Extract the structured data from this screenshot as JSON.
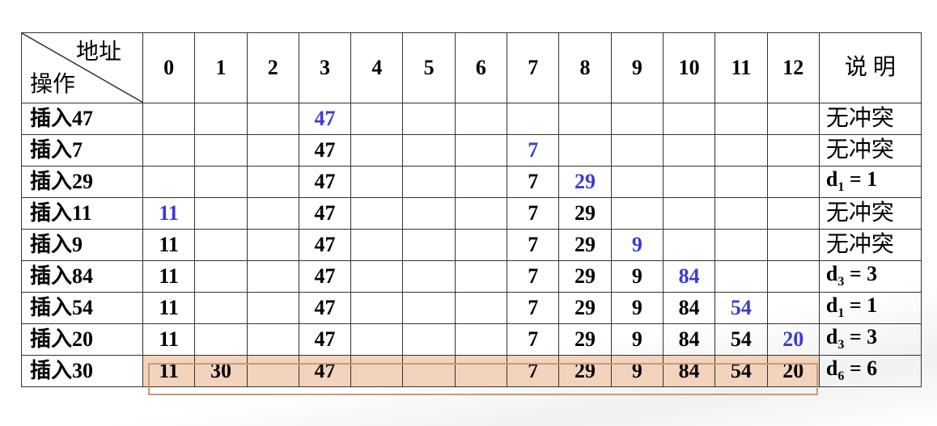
{
  "header": {
    "corner_top": "地址",
    "corner_bottom": "操作",
    "addresses": [
      "0",
      "1",
      "2",
      "3",
      "4",
      "5",
      "6",
      "7",
      "8",
      "9",
      "10",
      "11",
      "12"
    ],
    "note": "说 明"
  },
  "rows": [
    {
      "op": "插入47",
      "cells": [
        "",
        "",
        "",
        "47",
        "",
        "",
        "",
        "",
        "",
        "",
        "",
        "",
        ""
      ],
      "new_index": 3,
      "note": "无冲突",
      "note_type": "text"
    },
    {
      "op": "插入7",
      "cells": [
        "",
        "",
        "",
        "47",
        "",
        "",
        "",
        "7",
        "",
        "",
        "",
        "",
        ""
      ],
      "new_index": 7,
      "note": "无冲突",
      "note_type": "text"
    },
    {
      "op": "插入29",
      "cells": [
        "",
        "",
        "",
        "47",
        "",
        "",
        "",
        "7",
        "29",
        "",
        "",
        "",
        ""
      ],
      "new_index": 8,
      "note": {
        "d": "d",
        "sub": "1",
        "rest": " = 1"
      },
      "note_type": "eq"
    },
    {
      "op": "插入11",
      "cells": [
        "11",
        "",
        "",
        "47",
        "",
        "",
        "",
        "7",
        "29",
        "",
        "",
        "",
        ""
      ],
      "new_index": 0,
      "note": "无冲突",
      "note_type": "text"
    },
    {
      "op": "插入9",
      "cells": [
        "11",
        "",
        "",
        "47",
        "",
        "",
        "",
        "7",
        "29",
        "9",
        "",
        "",
        ""
      ],
      "new_index": 9,
      "note": "无冲突",
      "note_type": "text"
    },
    {
      "op": "插入84",
      "cells": [
        "11",
        "",
        "",
        "47",
        "",
        "",
        "",
        "7",
        "29",
        "9",
        "84",
        "",
        ""
      ],
      "new_index": 10,
      "note": {
        "d": "d",
        "sub": "3",
        "rest": " = 3"
      },
      "note_type": "eq"
    },
    {
      "op": "插入54",
      "cells": [
        "11",
        "",
        "",
        "47",
        "",
        "",
        "",
        "7",
        "29",
        "9",
        "84",
        "54",
        ""
      ],
      "new_index": 11,
      "note": {
        "d": "d",
        "sub": "1",
        "rest": " = 1"
      },
      "note_type": "eq"
    },
    {
      "op": "插入20",
      "cells": [
        "11",
        "",
        "",
        "47",
        "",
        "",
        "",
        "7",
        "29",
        "9",
        "84",
        "54",
        "20"
      ],
      "new_index": 12,
      "note": {
        "d": "d",
        "sub": "3",
        "rest": " = 3"
      },
      "note_type": "eq"
    },
    {
      "op": "插入30",
      "cells": [
        "11",
        "30",
        "",
        "47",
        "",
        "",
        "",
        "7",
        "29",
        "9",
        "84",
        "54",
        "20"
      ],
      "new_index": 1,
      "note": {
        "d": "d",
        "sub": "6",
        "rest": " = 6"
      },
      "note_type": "eq",
      "highlight": true
    }
  ],
  "colors": {
    "new_value": "#3a3ad6",
    "highlight_bg": "#f3d3bb"
  }
}
